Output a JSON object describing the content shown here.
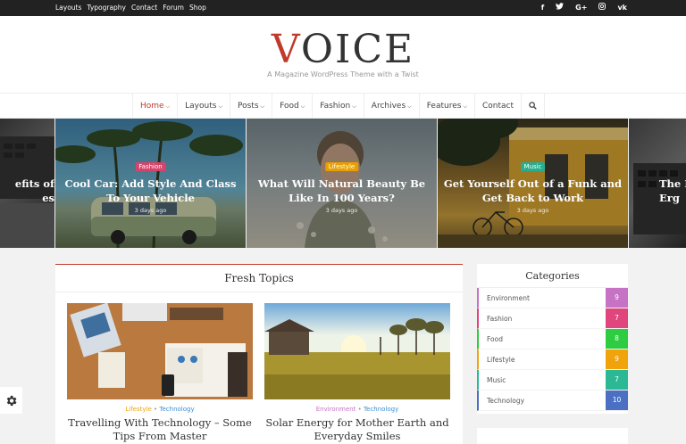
{
  "topbar": {
    "links": [
      "Layouts",
      "Typography",
      "Contact",
      "Forum",
      "Shop"
    ],
    "social": [
      {
        "icon": "facebook-icon",
        "glyph": "f"
      },
      {
        "icon": "twitter-icon",
        "glyph": "t"
      },
      {
        "icon": "google-plus-icon",
        "glyph": "G+"
      },
      {
        "icon": "instagram-icon",
        "glyph": "◎"
      },
      {
        "icon": "vk-icon",
        "glyph": "vk"
      }
    ]
  },
  "header": {
    "logo_first": "V",
    "logo_rest": "OICE",
    "tagline": "A Magazine WordPress Theme with a Twist"
  },
  "nav": {
    "items": [
      {
        "label": "Home",
        "caret": true,
        "active": true
      },
      {
        "label": "Layouts",
        "caret": true
      },
      {
        "label": "Posts",
        "caret": true
      },
      {
        "label": "Food",
        "caret": true
      },
      {
        "label": "Fashion",
        "caret": true
      },
      {
        "label": "Archives",
        "caret": true
      },
      {
        "label": "Features",
        "caret": true
      },
      {
        "label": "Contact",
        "caret": false
      }
    ],
    "search_glyph": "⚲"
  },
  "slider": {
    "left_partial": "efits of\nes",
    "right_partial": "The I\nErg",
    "slides": [
      {
        "category": "Fashion",
        "category_color": "#d6446b",
        "title": "Cool Car: Add Style And Class To Your Vehicle",
        "date": "3 days ago"
      },
      {
        "category": "Lifestyle",
        "category_color": "#e8a000",
        "title": "What Will Natural Beauty Be Like In 100 Years?",
        "date": "3 days ago"
      },
      {
        "category": "Music",
        "category_color": "#27ae8e",
        "title": "Get Yourself Out of a Funk and Get Back to Work",
        "date": "3 days ago"
      }
    ]
  },
  "fresh_topics": {
    "title": "Fresh Topics",
    "cards": [
      {
        "cat1": "Lifestyle",
        "cat2": "Technology",
        "title": "Travelling With Technology – Some Tips From Master"
      },
      {
        "cat1": "Environment",
        "cat2": "Technology",
        "title": "Solar Energy for Mother Earth and Everyday Smiles"
      }
    ]
  },
  "categories": {
    "title": "Categories",
    "items": [
      {
        "name": "Environment",
        "count": "9",
        "color": "#c673c6"
      },
      {
        "name": "Fashion",
        "count": "7",
        "color": "#e0457b"
      },
      {
        "name": "Food",
        "count": "8",
        "color": "#2ecc40"
      },
      {
        "name": "Lifestyle",
        "count": "9",
        "color": "#f0a30a"
      },
      {
        "name": "Music",
        "count": "7",
        "color": "#2bb894"
      },
      {
        "name": "Technology",
        "count": "10",
        "color": "#4a6fc3"
      }
    ]
  },
  "colors": {
    "accent": "#c0392b",
    "lifestyle": "#f0a30a",
    "technology": "#3a8fd6",
    "environment": "#c673c6"
  }
}
